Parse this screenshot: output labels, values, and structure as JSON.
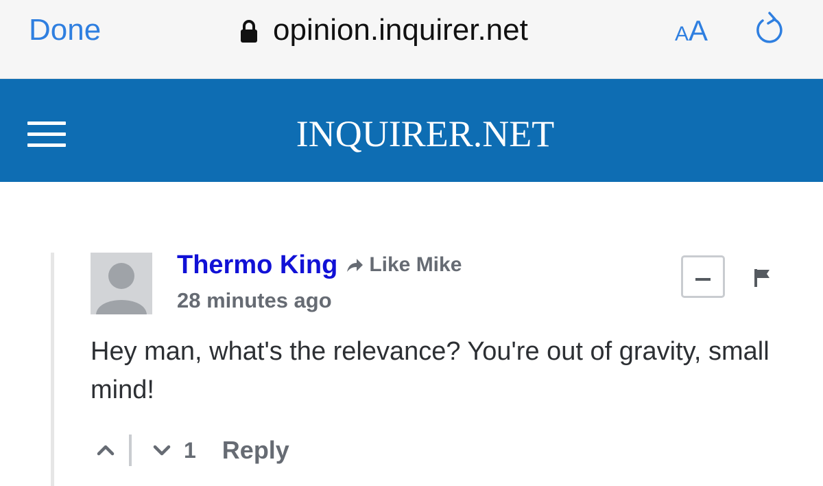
{
  "browser": {
    "done_label": "Done",
    "url": "opinion.inquirer.net",
    "text_size_small": "A",
    "text_size_large": "A",
    "accent_color": "#2f7fe0",
    "icons": [
      "lock-icon",
      "reload-icon"
    ]
  },
  "site_header": {
    "logo_text": "INQUIRER.NET",
    "background_color": "#0e6db3",
    "icons": [
      "menu-icon"
    ]
  },
  "comment": {
    "author": "Thermo King",
    "reply_to": "Like Mike",
    "timestamp": "28 minutes ago",
    "body": "Hey man, what's the relevance? You're out of gravity, small mind!",
    "downvote_count": "1",
    "reply_label": "Reply",
    "author_color": "#1111d6",
    "icons": [
      "avatar-placeholder-icon",
      "reply-arrow-icon",
      "collapse-icon",
      "flag-icon",
      "upvote-icon",
      "downvote-icon"
    ]
  }
}
